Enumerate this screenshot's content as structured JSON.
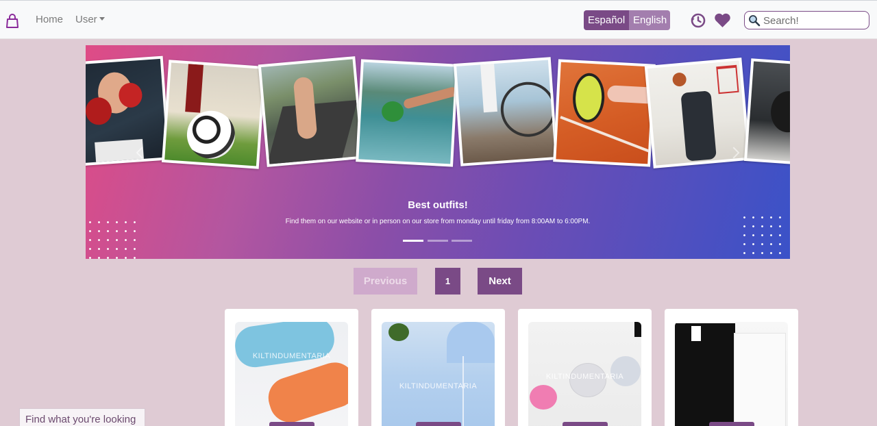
{
  "navbar": {
    "home_label": "Home",
    "user_label": "User",
    "lang_es": "Español",
    "lang_en": "English",
    "search_placeholder": "Search!",
    "icons": [
      "bag-icon",
      "history-icon",
      "heart-icon",
      "search-icon"
    ],
    "accent_color": "#7a4a86"
  },
  "carousel": {
    "title": "Best outfits!",
    "text": "Find them on our website or in person on our store from monday until friday from 8:00AM to 6:00PM.",
    "active_slide": 1,
    "slide_count": 3
  },
  "pagination": {
    "prev_label": "Previous",
    "page_label": "1",
    "next_label": "Next"
  },
  "products": {
    "watermark": "KILTINDUMENTARIA"
  },
  "helper": {
    "label": "Find what you're looking"
  }
}
